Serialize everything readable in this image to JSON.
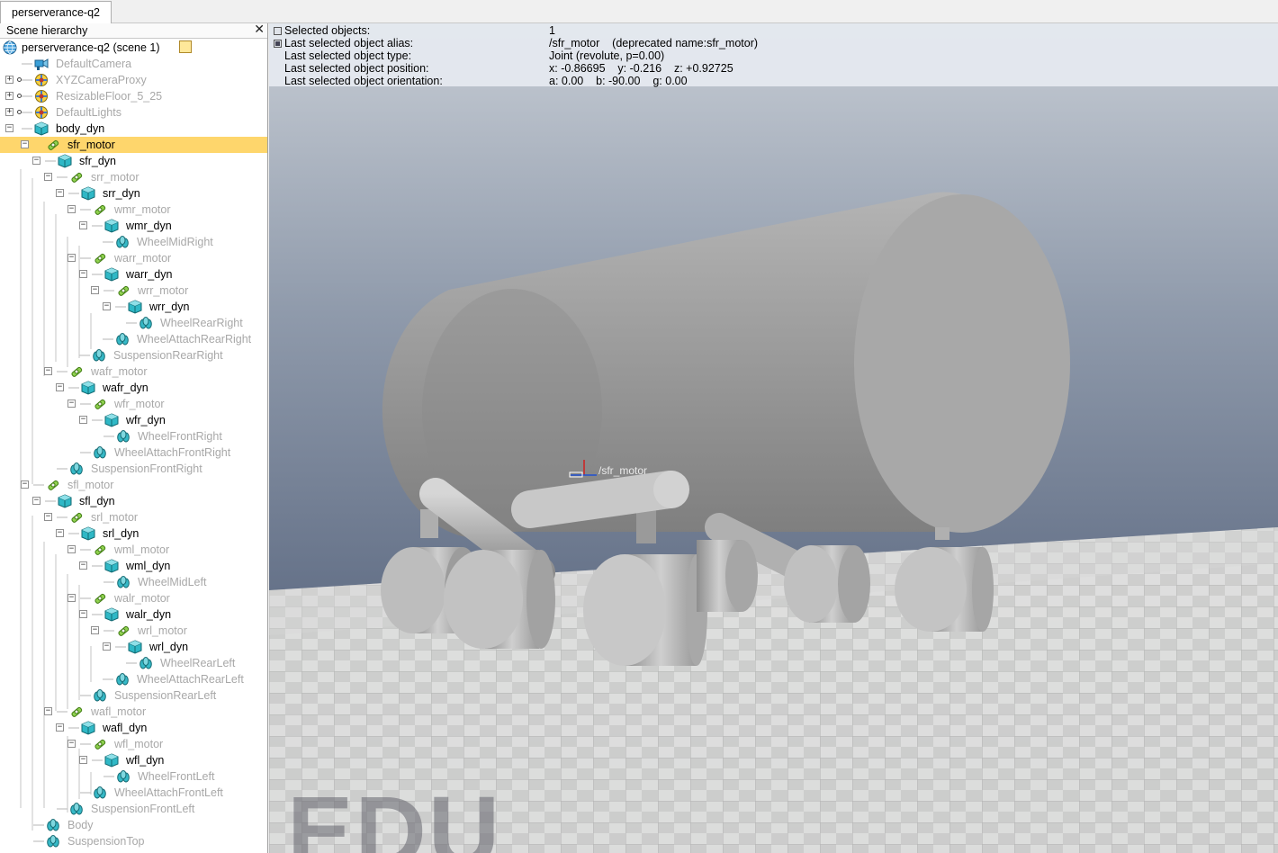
{
  "tab": {
    "title": "perserverance-q2"
  },
  "hierarchy": {
    "title": "Scene hierarchy",
    "close_glyph": "✕",
    "root_label": "perserverance-q2 (scene 1)",
    "items": [
      {
        "label": "DefaultCamera",
        "icon": "camera-icon",
        "dim": true
      },
      {
        "label": "XYZCameraProxy",
        "icon": "dummy-icon",
        "dim": true
      },
      {
        "label": "ResizableFloor_5_25",
        "icon": "dummy-icon",
        "dim": true
      },
      {
        "label": "DefaultLights",
        "icon": "dummy-icon",
        "dim": true
      },
      {
        "label": "body_dyn",
        "icon": "cuboid-icon",
        "dim": false
      },
      {
        "label": "sfr_motor",
        "icon": "joint-icon",
        "dim": false
      },
      {
        "label": "sfr_dyn",
        "icon": "cuboid-icon",
        "dim": false
      },
      {
        "label": "srr_motor",
        "icon": "joint-icon",
        "dim": true
      },
      {
        "label": "srr_dyn",
        "icon": "cuboid-icon",
        "dim": false
      },
      {
        "label": "wmr_motor",
        "icon": "joint-icon",
        "dim": true
      },
      {
        "label": "wmr_dyn",
        "icon": "cuboid-icon",
        "dim": false
      },
      {
        "label": "WheelMidRight",
        "icon": "shape-icon",
        "dim": true
      },
      {
        "label": "warr_motor",
        "icon": "joint-icon",
        "dim": true
      },
      {
        "label": "warr_dyn",
        "icon": "cuboid-icon",
        "dim": false
      },
      {
        "label": "wrr_motor",
        "icon": "joint-icon",
        "dim": true
      },
      {
        "label": "wrr_dyn",
        "icon": "cuboid-icon",
        "dim": false
      },
      {
        "label": "WheelRearRight",
        "icon": "shape-icon",
        "dim": true
      },
      {
        "label": "WheelAttachRearRight",
        "icon": "shape-icon",
        "dim": true
      },
      {
        "label": "SuspensionRearRight",
        "icon": "shape-icon",
        "dim": true
      },
      {
        "label": "wafr_motor",
        "icon": "joint-icon",
        "dim": true
      },
      {
        "label": "wafr_dyn",
        "icon": "cuboid-icon",
        "dim": false
      },
      {
        "label": "wfr_motor",
        "icon": "joint-icon",
        "dim": true
      },
      {
        "label": "wfr_dyn",
        "icon": "cuboid-icon",
        "dim": false
      },
      {
        "label": "WheelFrontRight",
        "icon": "shape-icon",
        "dim": true
      },
      {
        "label": "WheelAttachFrontRight",
        "icon": "shape-icon",
        "dim": true
      },
      {
        "label": "SuspensionFrontRight",
        "icon": "shape-icon",
        "dim": true
      },
      {
        "label": "sfl_motor",
        "icon": "joint-icon",
        "dim": true
      },
      {
        "label": "sfl_dyn",
        "icon": "cuboid-icon",
        "dim": false
      },
      {
        "label": "srl_motor",
        "icon": "joint-icon",
        "dim": true
      },
      {
        "label": "srl_dyn",
        "icon": "cuboid-icon",
        "dim": false
      },
      {
        "label": "wml_motor",
        "icon": "joint-icon",
        "dim": true
      },
      {
        "label": "wml_dyn",
        "icon": "cuboid-icon",
        "dim": false
      },
      {
        "label": "WheelMidLeft",
        "icon": "shape-icon",
        "dim": true
      },
      {
        "label": "walr_motor",
        "icon": "joint-icon",
        "dim": true
      },
      {
        "label": "walr_dyn",
        "icon": "cuboid-icon",
        "dim": false
      },
      {
        "label": "wrl_motor",
        "icon": "joint-icon",
        "dim": true
      },
      {
        "label": "wrl_dyn",
        "icon": "cuboid-icon",
        "dim": false
      },
      {
        "label": "WheelRearLeft",
        "icon": "shape-icon",
        "dim": true
      },
      {
        "label": "WheelAttachRearLeft",
        "icon": "shape-icon",
        "dim": true
      },
      {
        "label": "SuspensionRearLeft",
        "icon": "shape-icon",
        "dim": true
      },
      {
        "label": "wafl_motor",
        "icon": "joint-icon",
        "dim": true
      },
      {
        "label": "wafl_dyn",
        "icon": "cuboid-icon",
        "dim": false
      },
      {
        "label": "wfl_motor",
        "icon": "joint-icon",
        "dim": true
      },
      {
        "label": "wfl_dyn",
        "icon": "cuboid-icon",
        "dim": false
      },
      {
        "label": "WheelFrontLeft",
        "icon": "shape-icon",
        "dim": true
      },
      {
        "label": "WheelAttachFrontLeft",
        "icon": "shape-icon",
        "dim": true
      },
      {
        "label": "SuspensionFrontLeft",
        "icon": "shape-icon",
        "dim": true
      },
      {
        "label": "Body",
        "icon": "shape-icon",
        "dim": true
      },
      {
        "label": "SuspensionTop",
        "icon": "shape-icon",
        "dim": true
      }
    ]
  },
  "info": {
    "rows": [
      {
        "label": "Selected objects:",
        "value": "1"
      },
      {
        "label": "Last selected object alias:",
        "value": "/sfr_motor    (deprecated name:sfr_motor)"
      },
      {
        "label": "Last selected object type:",
        "value": "Joint (revolute, p=0.00)"
      },
      {
        "label": "Last selected object position:",
        "value": "x: -0.86695    y: -0.216    z: +0.92725"
      },
      {
        "label": "Last selected object orientation:",
        "value": "a: 0.00    b: -90.00    g: 0.00"
      }
    ]
  },
  "scene": {
    "object_label": "/sfr_motor",
    "watermark": "EDU"
  },
  "colors": {
    "selection": "#fed66c",
    "sky_top": "#c4cad2",
    "sky_bottom": "#3f4d69",
    "floor_light": "#e8e8e6",
    "floor_dark": "#c9c9c7"
  }
}
